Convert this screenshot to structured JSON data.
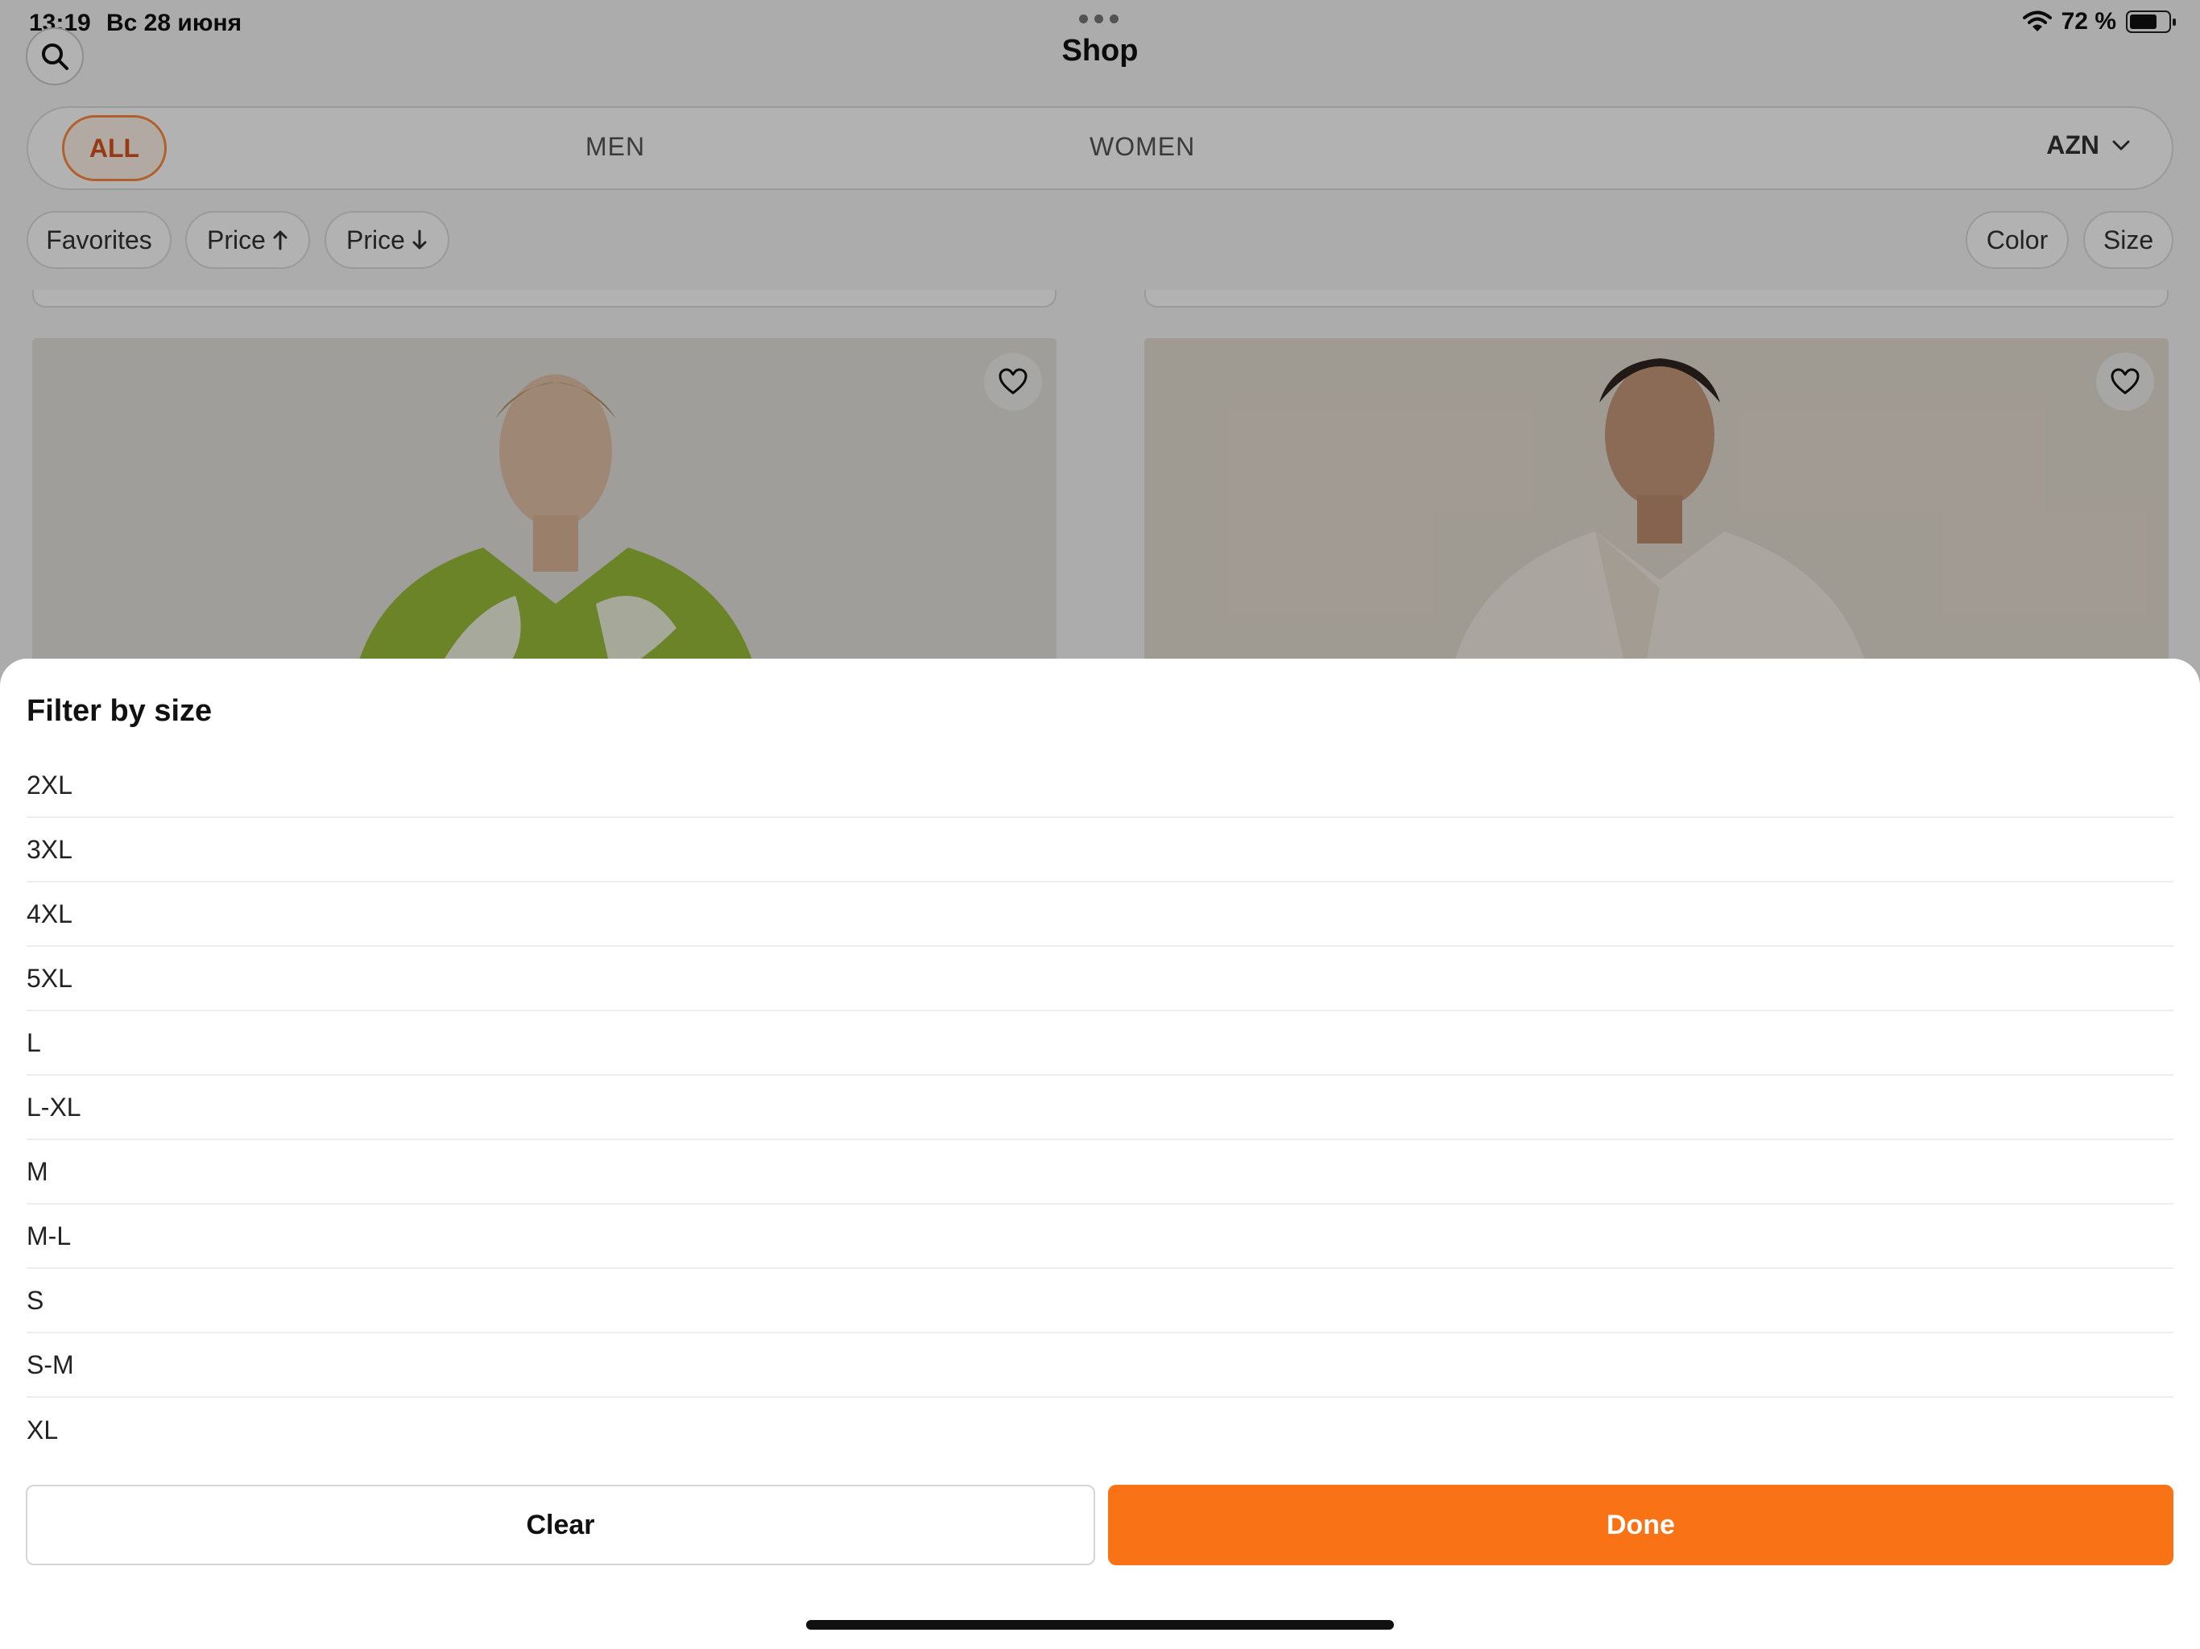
{
  "status_bar": {
    "time": "13:19",
    "date": "Вс 28 июня",
    "battery": "72 %",
    "battery_level": 0.72
  },
  "header": {
    "title": "Shop"
  },
  "segments": {
    "all": "ALL",
    "men": "MEN",
    "women": "WOMEN",
    "currency": "AZN",
    "active": "ALL"
  },
  "filters": {
    "favorites": "Favorites",
    "price_asc": "Price",
    "price_desc": "Price",
    "color": "Color",
    "size": "Size"
  },
  "sheet": {
    "title": "Filter by size",
    "sizes": [
      "2XL",
      "3XL",
      "4XL",
      "5XL",
      "L",
      "L-XL",
      "M",
      "M-L",
      "S",
      "S-M",
      "XL"
    ],
    "clear_label": "Clear",
    "done_label": "Done"
  },
  "colors": {
    "accent": "#f97316",
    "active_tab_text": "#d9531e",
    "active_tab_border": "#ff8a3d"
  }
}
